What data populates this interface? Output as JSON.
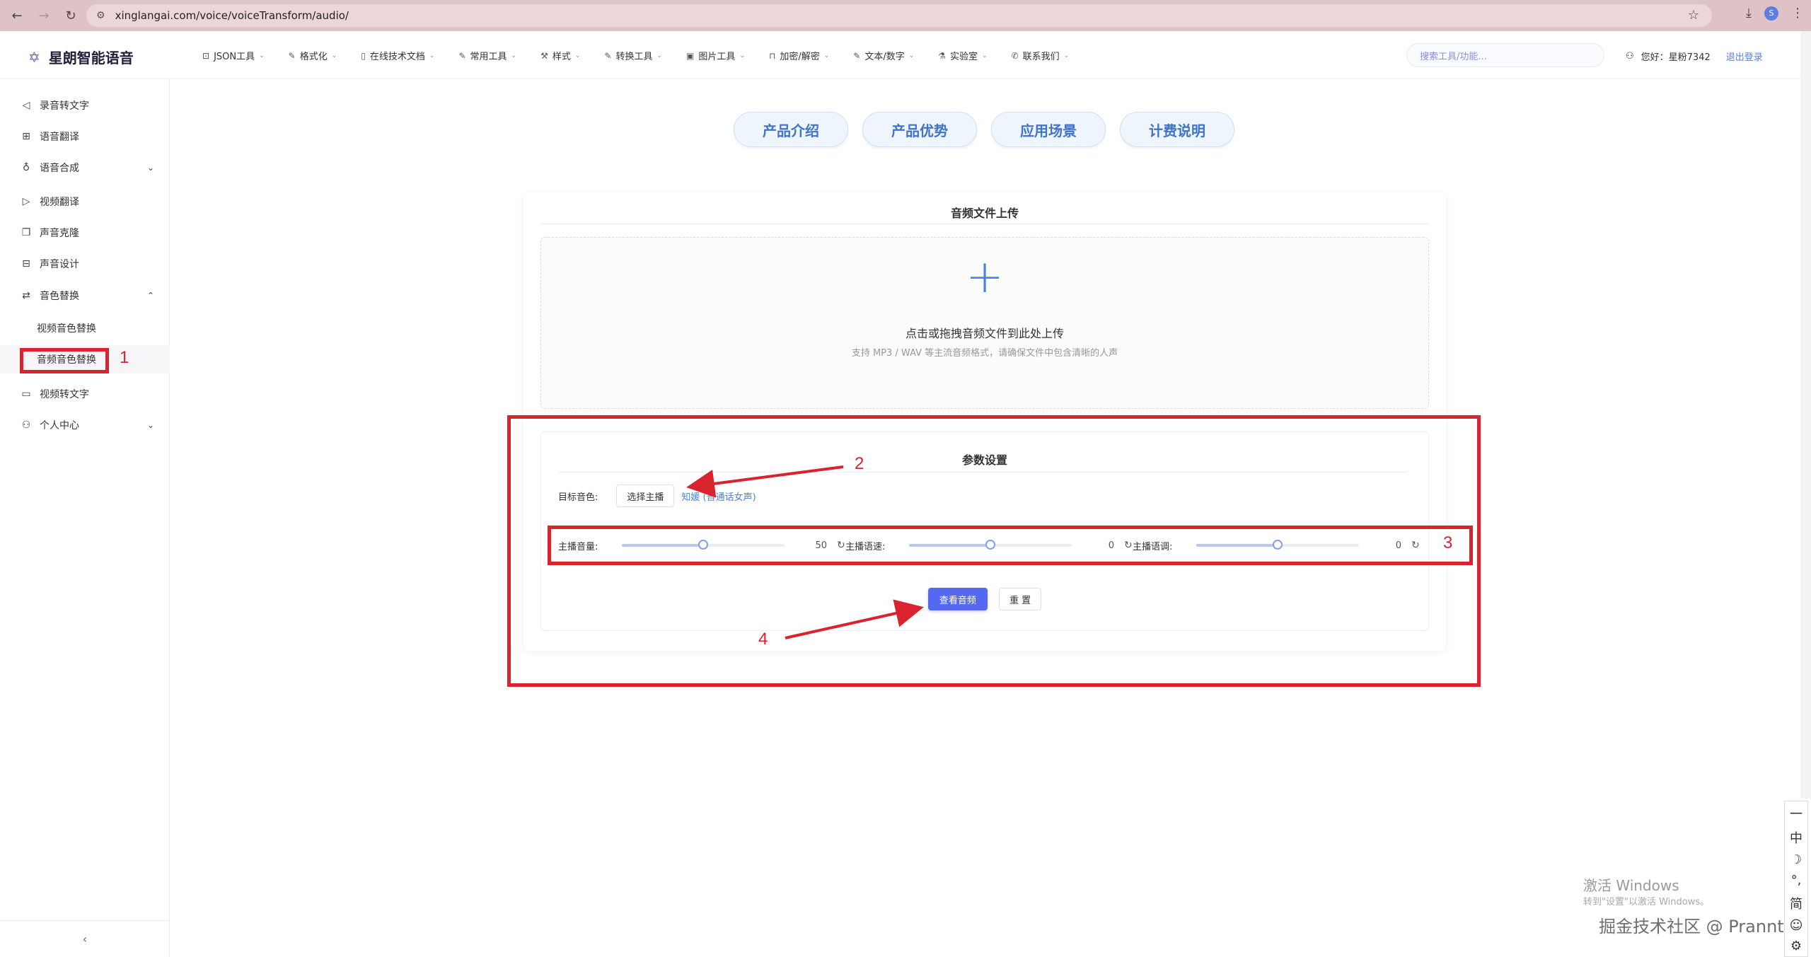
{
  "browser": {
    "url": "xinglangai.com/voice/voiceTransform/audio/",
    "profile_initial": "S"
  },
  "header": {
    "brand": "星朗智能语音",
    "nav": [
      {
        "label": "JSON工具",
        "icon": "json-icon"
      },
      {
        "label": "格式化",
        "icon": "edit-icon"
      },
      {
        "label": "在线技术文档",
        "icon": "document-icon"
      },
      {
        "label": "常用工具",
        "icon": "edit-icon"
      },
      {
        "label": "样式",
        "icon": "brush-icon"
      },
      {
        "label": "转换工具",
        "icon": "edit-icon"
      },
      {
        "label": "图片工具",
        "icon": "image-icon"
      },
      {
        "label": "加密/解密",
        "icon": "lock-icon"
      },
      {
        "label": "文本/数字",
        "icon": "edit-icon"
      },
      {
        "label": "实验室",
        "icon": "flask-icon"
      },
      {
        "label": "联系我们",
        "icon": "phone-icon"
      }
    ],
    "search_placeholder": "搜索工具/功能...",
    "greeting": "您好：星粉7342",
    "logout": "退出登录"
  },
  "sidebar": {
    "items": [
      {
        "label": "录音转文字"
      },
      {
        "label": "语音翻译"
      },
      {
        "label": "语音合成"
      },
      {
        "label": "视频翻译"
      },
      {
        "label": "声音克隆"
      },
      {
        "label": "声音设计"
      },
      {
        "label": "音色替换"
      },
      {
        "label": "视频转文字"
      },
      {
        "label": "个人中心"
      }
    ],
    "sub_items": [
      {
        "label": "视频音色替换"
      },
      {
        "label": "音频音色替换"
      }
    ]
  },
  "tabs": [
    "产品介绍",
    "产品优势",
    "应用场景",
    "计费说明"
  ],
  "upload": {
    "title": "音频文件上传",
    "main_text": "点击或拖拽音频文件到此处上传",
    "hint": "支持 MP3 / WAV 等主流音频格式，请确保文件中包含清晰的人声"
  },
  "params": {
    "title": "参数设置",
    "target_voice_label": "目标音色:",
    "select_button": "选择主播",
    "selected_voice": "知媛 (普通话女声)",
    "sliders": [
      {
        "label": "主播音量:",
        "value": "50",
        "fraction": 0.5
      },
      {
        "label": "主播语速:",
        "value": "0",
        "fraction": 0.5
      },
      {
        "label": "主播语调:",
        "value": "0",
        "fraction": 0.5
      }
    ],
    "submit": "查看音频",
    "reset": "重 置"
  },
  "annotations": [
    "1",
    "2",
    "3",
    "4"
  ],
  "ime": [
    "一",
    "中",
    "☽",
    "°,",
    "简",
    "☺",
    "⚙"
  ],
  "watermarks": {
    "windows": "激活 Windows",
    "windows_hint": "转到\"设置\"以激活 Windows。",
    "juejin": "掘金技术社区 @ Prannt"
  },
  "colors": {
    "accent": "#5468f0",
    "annotation": "#d9232e",
    "tab_text": "#3f74c8"
  }
}
